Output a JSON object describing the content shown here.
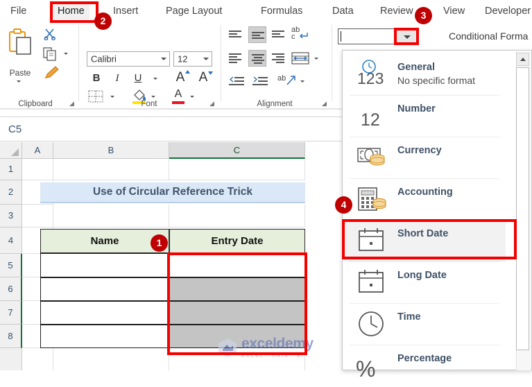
{
  "ribbon": {
    "tabs": [
      {
        "label": "File",
        "selected": false
      },
      {
        "label": "Home",
        "selected": true
      },
      {
        "label": "Insert",
        "selected": false
      },
      {
        "label": "Page Layout",
        "selected": false
      },
      {
        "label": "Formulas",
        "selected": false
      },
      {
        "label": "Data",
        "selected": false
      },
      {
        "label": "Review",
        "selected": false
      },
      {
        "label": "View",
        "selected": false
      },
      {
        "label": "Developer",
        "selected": false
      }
    ],
    "groups": {
      "clipboard": {
        "label": "Clipboard",
        "paste_label": "Paste"
      },
      "font": {
        "label": "Font",
        "font_name": "Calibri",
        "font_size": "12",
        "bold": "B",
        "italic": "I",
        "underline": "U",
        "grow_font": "A",
        "shrink_font": "A"
      },
      "alignment": {
        "label": "Alignment",
        "wrap_text": "ab"
      },
      "number": {
        "value": "",
        "placeholder": ""
      },
      "styles": {
        "conditional_formatting": "Conditional Forma"
      }
    }
  },
  "formula_bar": {
    "name_box": "C5",
    "formula": ""
  },
  "sheet": {
    "columns": [
      "A",
      "B",
      "C"
    ],
    "selected_column": "C",
    "rows": [
      "1",
      "2",
      "3",
      "4",
      "5",
      "6",
      "7",
      "8"
    ],
    "selected_rows": [
      "5",
      "6",
      "7",
      "8"
    ],
    "title": "Use of Circular Reference Trick",
    "headers": [
      "Name",
      "Entry Date"
    ],
    "data_rows": [
      {
        "name": "",
        "entry_date": ""
      },
      {
        "name": "",
        "entry_date": ""
      },
      {
        "name": "",
        "entry_date": ""
      },
      {
        "name": "",
        "entry_date": ""
      }
    ],
    "colors": {
      "title_fill": "#dbe8f7",
      "title_text": "#40546c",
      "header_fill": "#e6efdb",
      "selection_fill": "#c4c4c4",
      "active_cell": "#ffffff",
      "tab_accent": "#0f7236"
    }
  },
  "dropdown": {
    "items": [
      {
        "name": "General",
        "sub": "No specific format",
        "icon": "number-123-icon",
        "highlighted": false
      },
      {
        "name": "Number",
        "sub": "",
        "icon": "number-12-icon",
        "highlighted": false
      },
      {
        "name": "Currency",
        "sub": "",
        "icon": "currency-banknote-coins-icon",
        "highlighted": false
      },
      {
        "name": "Accounting",
        "sub": "",
        "icon": "accounting-calculator-coins-icon",
        "highlighted": false
      },
      {
        "name": "Short Date",
        "sub": "",
        "icon": "calendar-icon",
        "highlighted": true
      },
      {
        "name": "Long Date",
        "sub": "",
        "icon": "calendar-icon",
        "highlighted": false
      },
      {
        "name": "Time",
        "sub": "",
        "icon": "clock-icon",
        "highlighted": false
      },
      {
        "name": "Percentage",
        "sub": "",
        "icon": "percent-icon",
        "highlighted": false
      }
    ]
  },
  "annotations": {
    "badges": [
      {
        "label": "1",
        "target": "entry-date-column-range"
      },
      {
        "label": "2",
        "target": "home-tab"
      },
      {
        "label": "3",
        "target": "number-format-dropdown-arrow"
      },
      {
        "label": "4",
        "target": "short-date-option"
      }
    ],
    "accent_color": "#f40000",
    "badge_color": "#c00000"
  },
  "watermark": {
    "brand": "exceldemy",
    "tagline": "EXCEL · DATA · BI"
  }
}
